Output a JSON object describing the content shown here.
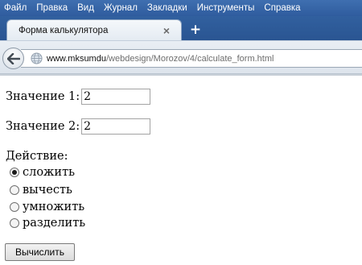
{
  "browser": {
    "menu": [
      "Файл",
      "Правка",
      "Вид",
      "Журнал",
      "Закладки",
      "Инструменты",
      "Справка"
    ],
    "tab_title": "Форма калькулятора",
    "tab_close": "×",
    "new_tab": "+",
    "url_host": "www.mksumdu",
    "url_path": "/webdesign/Morozov/4/calculate_form.html",
    "icons": {
      "back": "back-arrow-icon",
      "site": "globe-icon",
      "close": "close-icon",
      "new_tab": "plus-icon"
    }
  },
  "form": {
    "value1_label": "Значение 1:",
    "value1": "2",
    "value2_label": "Значение 2:",
    "value2": "2",
    "action_label": "Действие:",
    "actions": [
      {
        "label": "сложить",
        "checked": true
      },
      {
        "label": "вычесть",
        "checked": false
      },
      {
        "label": "умножить",
        "checked": false
      },
      {
        "label": "разделить",
        "checked": false
      }
    ],
    "submit_label": "Вычислить"
  },
  "colors": {
    "titlebar": "#2f5c9e",
    "menu_text": "#ffffff"
  }
}
